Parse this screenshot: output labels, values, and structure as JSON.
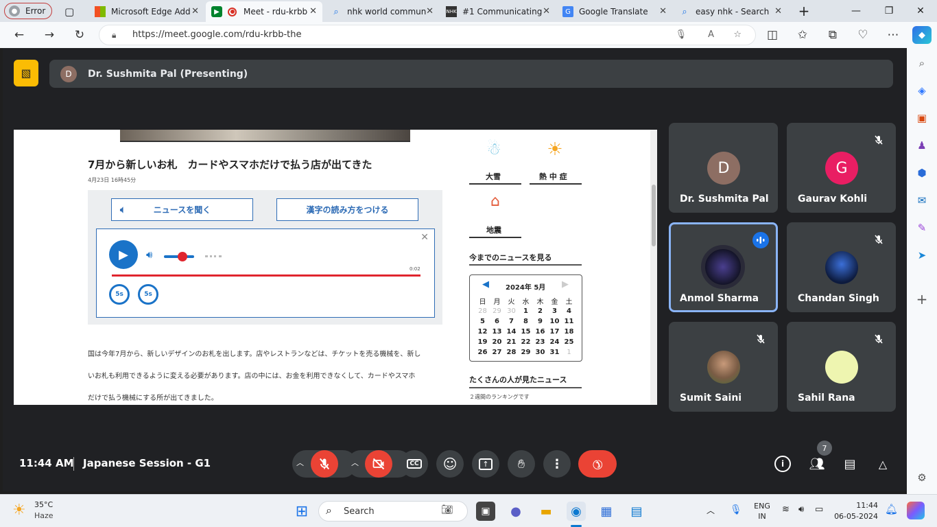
{
  "tabs": [
    {
      "label": "Error",
      "favicon": "profile-icon"
    },
    {
      "label": "Microsoft Edge Add",
      "favicon": "microsoft-logo"
    },
    {
      "label": "Meet - rdu-krbb",
      "favicon": "meet-logo",
      "active": true
    },
    {
      "label": "nhk world commun",
      "favicon": "search-icon"
    },
    {
      "label": "#1 Communicating",
      "favicon": "nhk-logo"
    },
    {
      "label": "Google Translate",
      "favicon": "translate-icon"
    },
    {
      "label": "easy nhk - Search",
      "favicon": "search-icon"
    }
  ],
  "address": {
    "url": "https://meet.google.com/rdu-krbb-the"
  },
  "meeting": {
    "presenter_initial": "D",
    "presenter_label": "Dr. Sushmita Pal (Presenting)",
    "time": "11:44 AM",
    "title": "Japanese Session - G1",
    "people_count": "7"
  },
  "slide": {
    "headline": "7月から新しいお札　カードやスマホだけで払う店が出てきた",
    "date": "4月23日 16時45分",
    "listen_button": "ニュースを聞く",
    "furigana_button": "漢字の読み方をつける",
    "audio_time": "0:02",
    "skip_back": "5s",
    "skip_fwd": "5s",
    "para1": "国は今年7月から、新しいデザインのお札を出します。店やレストランなどは、チケットを売る機械を、新し",
    "para2": "いお札も利用できるように変える必要があります。店の中には、お金を利用できなくして、カードやスマホ",
    "para3": "だけで払う機械にする所が出てきました。",
    "weather": [
      {
        "label": "大雪"
      },
      {
        "label": "熱 中 症"
      },
      {
        "label": "地震"
      }
    ],
    "past_news": "今までのニュースを見る",
    "calendar": {
      "month": "2024年 5月",
      "weekdays": [
        "日",
        "月",
        "火",
        "水",
        "木",
        "金",
        "土"
      ],
      "weeks": [
        [
          "28",
          "29",
          "30",
          "1",
          "2",
          "3",
          "4"
        ],
        [
          "5",
          "6",
          "7",
          "8",
          "9",
          "10",
          "11"
        ],
        [
          "12",
          "13",
          "14",
          "15",
          "16",
          "17",
          "18"
        ],
        [
          "19",
          "20",
          "21",
          "22",
          "23",
          "24",
          "25"
        ],
        [
          "26",
          "27",
          "28",
          "29",
          "30",
          "31",
          "1"
        ]
      ]
    },
    "popular_news": "たくさんの人が見たニュース",
    "ranking": "２週間のランキングです"
  },
  "participants": [
    {
      "name": "Dr. Sushmita Pal",
      "initial": "D",
      "color": "#8d6e63",
      "muted": false
    },
    {
      "name": "Gaurav Kohli",
      "initial": "G",
      "color": "#e91e63",
      "muted": true
    },
    {
      "name": "Anmol Sharma",
      "initial": "",
      "color": "#1a1a2e",
      "muted": false,
      "speaking": true
    },
    {
      "name": "Chandan Singh",
      "initial": "",
      "color": "#0d1b3e",
      "muted": true
    },
    {
      "name": "Sumit Saini",
      "initial": "",
      "color": "#7a5c45",
      "muted": true
    },
    {
      "name": "Sahil Rana",
      "initial": "",
      "color": "#eef5b0",
      "muted": true
    }
  ],
  "taskbar": {
    "temp": "35°C",
    "weather": "Haze",
    "search_placeholder": "Search",
    "lang1": "ENG",
    "lang2": "IN",
    "clock": "11:44",
    "date": "06-05-2024"
  },
  "colors": {
    "accent": "#8ab4f8",
    "danger": "#ea4335",
    "meet_bg": "#202124"
  }
}
